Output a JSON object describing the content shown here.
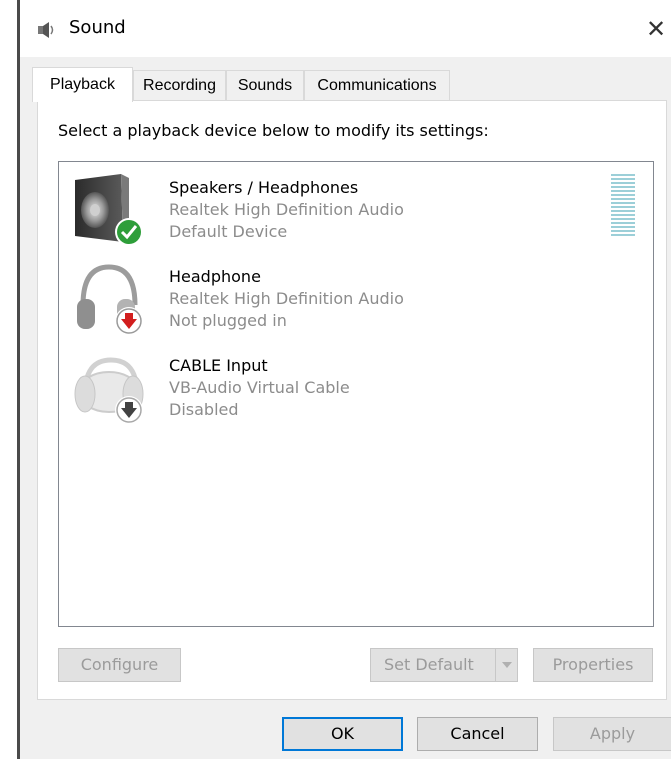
{
  "window": {
    "title": "Sound",
    "title_icon": "speaker-icon",
    "close_glyph": "✕"
  },
  "tabs": [
    {
      "label": "Playback",
      "active": true
    },
    {
      "label": "Recording",
      "active": false
    },
    {
      "label": "Sounds",
      "active": false
    },
    {
      "label": "Communications",
      "active": false
    }
  ],
  "playback": {
    "instruction": "Select a playback device below to modify its settings:",
    "devices": [
      {
        "name": "Speakers / Headphones",
        "driver": "Realtek High Definition Audio",
        "state": "Default Device",
        "icon": "speaker-icon",
        "badge": "check-badge-icon",
        "badge_color": "#2e9e3a"
      },
      {
        "name": "Headphone",
        "driver": "Realtek High Definition Audio",
        "state": "Not plugged in",
        "icon": "headphone-icon",
        "badge": "red-down-arrow-badge-icon",
        "badge_color": "#d21e1e"
      },
      {
        "name": "CABLE Input",
        "driver": "VB-Audio Virtual Cable",
        "state": "Disabled",
        "icon": "headphone-icon",
        "badge": "black-down-arrow-badge-icon",
        "badge_color": "#222222"
      }
    ],
    "level_meter_color": "#9ccfd8"
  },
  "buttons": {
    "configure": "Configure",
    "set_default": "Set Default",
    "properties": "Properties",
    "ok": "OK",
    "cancel": "Cancel",
    "apply": "Apply"
  },
  "colors": {
    "accent": "#0078d7",
    "disabled_text": "#9b9b9b",
    "secondary_text": "#8c8c8c"
  }
}
